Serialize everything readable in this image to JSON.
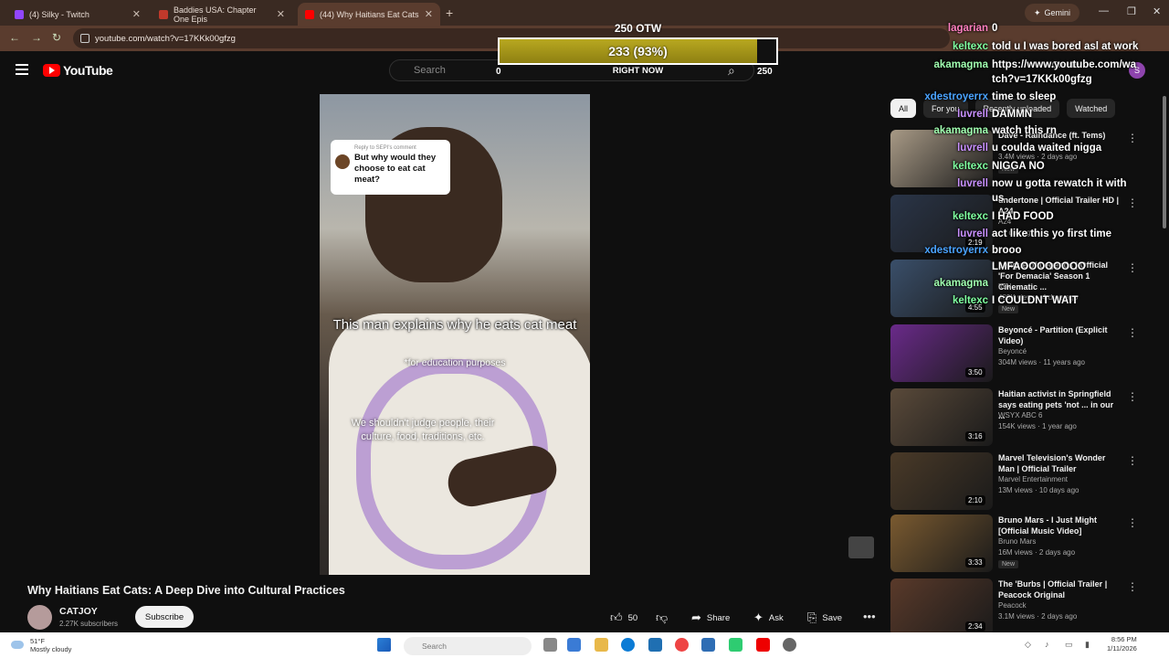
{
  "browser": {
    "tabs": [
      {
        "label": "(4) Silky - Twitch",
        "favicon_color": "#9146ff"
      },
      {
        "label": "Baddies USA: Chapter One Epis",
        "favicon_color": "#c0392b"
      },
      {
        "label": "(44) Why Haitians Eat Cats",
        "favicon_color": "#ff0000"
      }
    ],
    "new_tab_icon": "plus-icon",
    "gemini_label": "Gemini",
    "url": "youtube.com/watch?v=17KKk00gfzg"
  },
  "youtube": {
    "logo_text": "YouTube",
    "search_placeholder": "Search",
    "create_label": "+ Create",
    "avatar_letter": "S",
    "chips": [
      "All",
      "For you",
      "Recently uploaded",
      "Watched"
    ]
  },
  "video": {
    "reply_label": "Reply to SEPI's comment",
    "reply_question": "But why would they choose to eat cat meat?",
    "caption_main": "This man explains why he eats cat meat",
    "caption_sub": "*for education purposes",
    "caption_bottom": "We shouldn't judge people, their culture, food, traditions, etc.",
    "title": "Why Haitians Eat Cats: A Deep Dive into Cultural Practices",
    "channel": "CATJOY",
    "subscribers": "2.27K subscribers",
    "subscribe_label": "Subscribe",
    "likes": "50",
    "share_label": "Share",
    "ask_label": "Ask",
    "save_label": "Save"
  },
  "recommendations": [
    {
      "title": "Dave - Raindance (ft. Tems)",
      "channel": "",
      "meta": "3.4M views · 2 days ago",
      "duration": "",
      "badge": "New",
      "thumb_color": "#a89a86"
    },
    {
      "title": "undertone | Official Trailer HD | A24",
      "channel": "A24",
      "meta": "· 1 day ago",
      "duration": "2:19",
      "badge": "",
      "thumb_color": "#2a3548"
    },
    {
      "title": "League of Legends | Official 'For Demacia' Season 1 Cinematic ...",
      "channel": "IGN",
      "meta": "489K views · 4 days ago",
      "duration": "4:55",
      "badge": "New",
      "thumb_color": "#3a4f6a"
    },
    {
      "title": "Beyoncé - Partition (Explicit Video)",
      "channel": "Beyoncé",
      "meta": "304M views · 11 years ago",
      "duration": "3:50",
      "badge": "",
      "thumb_color": "#6a2a8a"
    },
    {
      "title": "Haitian activist in Springfield says eating pets 'not ... in our ...",
      "channel": "WSYX ABC 6",
      "meta": "154K views · 1 year ago",
      "duration": "3:16",
      "badge": "",
      "thumb_color": "#5a4a3a"
    },
    {
      "title": "Marvel Television's Wonder Man | Official Trailer",
      "channel": "Marvel Entertainment",
      "meta": "13M views · 10 days ago",
      "duration": "2:10",
      "badge": "",
      "thumb_color": "#4a3a28"
    },
    {
      "title": "Bruno Mars - I Just Might [Official Music Video]",
      "channel": "Bruno Mars",
      "meta": "16M views · 2 days ago",
      "duration": "3:33",
      "badge": "New",
      "thumb_color": "#7a5a30"
    },
    {
      "title": "The 'Burbs | Official Trailer | Peacock Original",
      "channel": "Peacock",
      "meta": "3.1M views · 2 days ago",
      "duration": "2:34",
      "badge": "",
      "thumb_color": "#5a3a2a"
    }
  ],
  "overlay": {
    "goal_label": "250 OTW",
    "current_label": "233 (93%)",
    "progress_fraction": 0.93,
    "min_label": "0",
    "now_label": "RIGHT NOW",
    "max_label": "250"
  },
  "chat": [
    {
      "user": "lagarian",
      "text": "0",
      "color": "#ff80c0"
    },
    {
      "user": "keltexc",
      "text": "told u I was bored asl at work",
      "color": "#7fffa0"
    },
    {
      "user": "akamagma",
      "text": "https://www.youtube.com/wa",
      "color": "#a0ffb0"
    },
    {
      "user": "",
      "text": "tch?v=17KKk00gfzg",
      "color": "#a0ffb0"
    },
    {
      "user": "xdestroyerrx",
      "text": "time to sleep",
      "color": "#4aa3ff"
    },
    {
      "user": "luvrell",
      "text": "DAMMN",
      "color": "#c890ff"
    },
    {
      "user": "akamagma",
      "text": "watch this rn",
      "color": "#a0ffb0"
    },
    {
      "user": "luvrell",
      "text": "u couldа waited nigga",
      "color": "#c890ff"
    },
    {
      "user": "keltexc",
      "text": "NIGGA NO",
      "color": "#7fffa0"
    },
    {
      "user": "luvrell",
      "text": "now u gotta rewatch it with",
      "color": "#c890ff"
    },
    {
      "user": "",
      "text": "us",
      "color": "#c890ff"
    },
    {
      "user": "keltexc",
      "text": "I HAD FOOD",
      "color": "#7fffa0"
    },
    {
      "user": "luvrell",
      "text": "act like this yo first time",
      "color": "#c890ff"
    },
    {
      "user": "xdestroyerrx",
      "text": "brooo",
      "color": "#4aa3ff"
    },
    {
      "user": "",
      "text": "LMFAOOOOOOOO",
      "color": "#a0ffb0"
    },
    {
      "user": "akamagma",
      "text": "",
      "color": "#a0ffb0"
    },
    {
      "user": "keltexc",
      "text": "I COULDNT WAIT",
      "color": "#7fffa0"
    }
  ],
  "taskbar": {
    "temp": "51°F",
    "weather": "Mostly cloudy",
    "search_placeholder": "Search",
    "time": "8:56 PM",
    "date": "1/11/2026"
  }
}
